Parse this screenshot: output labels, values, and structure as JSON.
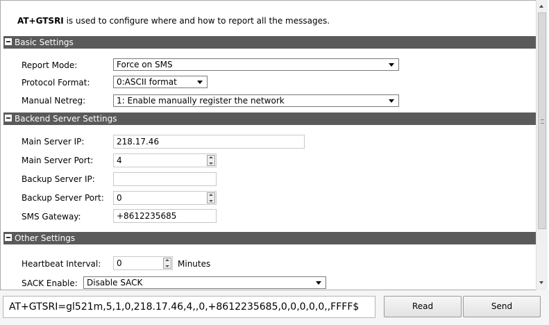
{
  "intro": {
    "command": "AT+GTSRI",
    "text": " is used to configure where and how to report all the messages."
  },
  "sections": {
    "basic": {
      "title": "Basic Settings"
    },
    "backend": {
      "title": "Backend Server Settings"
    },
    "other": {
      "title": "Other Settings"
    }
  },
  "basic": {
    "report_mode": {
      "label": "Report Mode:",
      "value": "Force on SMS"
    },
    "protocol_format": {
      "label": "Protocol Format:",
      "value": "0:ASCII format"
    },
    "manual_netreg": {
      "label": "Manual Netreg:",
      "value": "1: Enable manually register the network"
    }
  },
  "backend": {
    "main_ip": {
      "label": "Main Server IP:",
      "value": "218.17.46"
    },
    "main_port": {
      "label": "Main Server Port:",
      "value": "4"
    },
    "backup_ip": {
      "label": "Backup Server IP:",
      "value": ""
    },
    "backup_port": {
      "label": "Backup Server Port:",
      "value": "0"
    },
    "sms_gateway": {
      "label": "SMS Gateway:",
      "value": "+8612235685"
    }
  },
  "other": {
    "heartbeat": {
      "label": "Heartbeat Interval:",
      "value": "0",
      "unit": "Minutes"
    },
    "sack": {
      "label": "SACK Enable:",
      "value": "Disable SACK"
    }
  },
  "command_line": "AT+GTSRI=gl521m,5,1,0,218.17.46,4,,0,+8612235685,0,0,0,0,0,,FFFF$",
  "buttons": {
    "read": "Read",
    "send": "Send"
  }
}
